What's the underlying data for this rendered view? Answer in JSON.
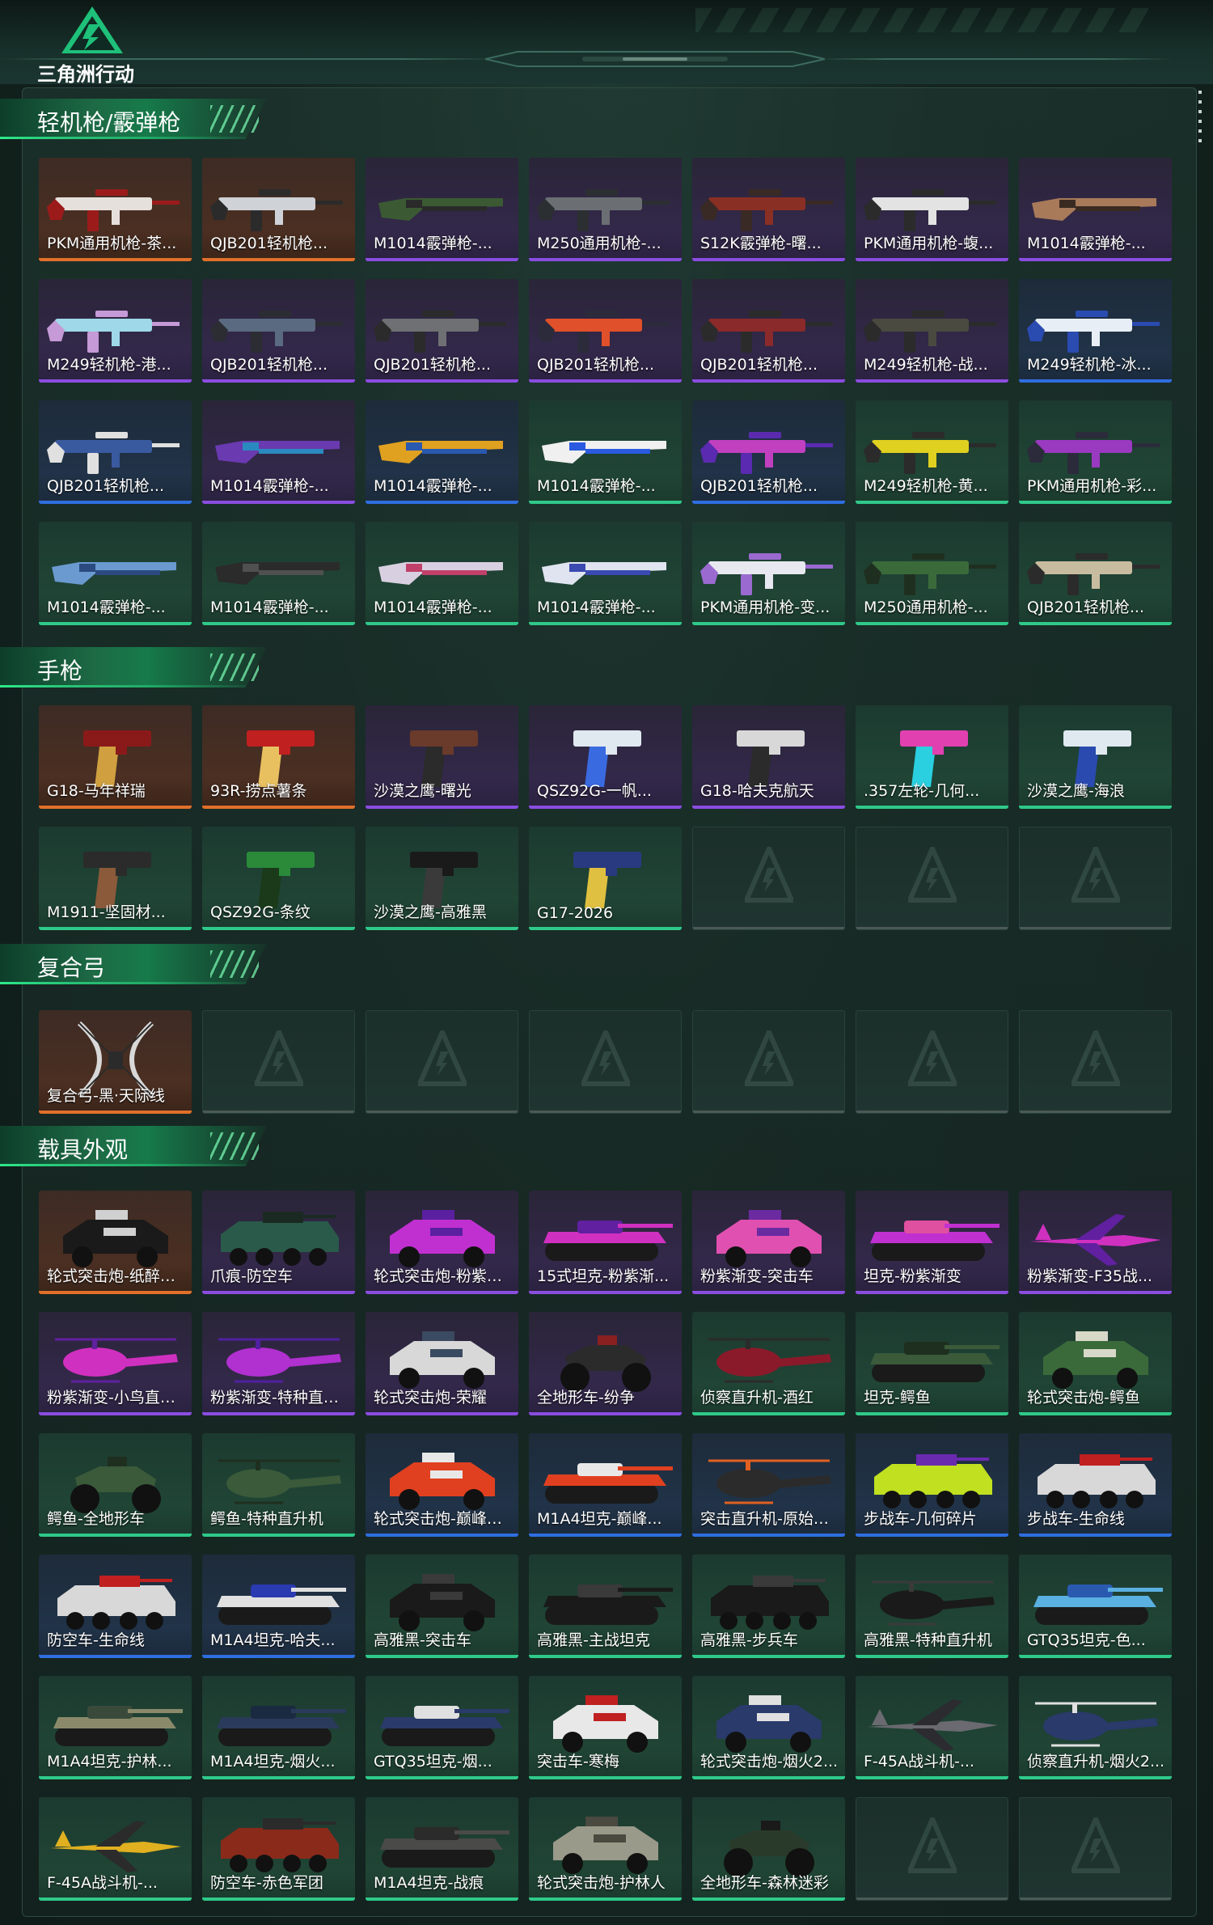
{
  "app": {
    "logo_text": "三角洲行动"
  },
  "sections": [
    {
      "title": "轻机枪/霰弹枪",
      "items": [
        {
          "label": "PKM通用机枪-茶...",
          "rarity": "orange",
          "kind": "rifle",
          "c1": "#e6e0dc",
          "c2": "#9b1b1b"
        },
        {
          "label": "QJB201轻机枪...",
          "rarity": "orange",
          "kind": "rifle",
          "c1": "#cfd2d6",
          "c2": "#2b2b2b"
        },
        {
          "label": "M1014霰弹枪-...",
          "rarity": "purple",
          "kind": "shotgun",
          "c1": "#3b5a33",
          "c2": "#2a2a2a"
        },
        {
          "label": "M250通用机枪-...",
          "rarity": "purple",
          "kind": "rifle",
          "c1": "#6b6f73",
          "c2": "#2c2f31"
        },
        {
          "label": "S12K霰弹枪-曙...",
          "rarity": "purple",
          "kind": "rifle",
          "c1": "#8a2f24",
          "c2": "#3a2a25"
        },
        {
          "label": "PKM通用机枪-蝮...",
          "rarity": "purple",
          "kind": "rifle",
          "c1": "#e3e3e3",
          "c2": "#2b2b2b"
        },
        {
          "label": "M1014霰弹枪-...",
          "rarity": "purple",
          "kind": "shotgun",
          "c1": "#a87a5a",
          "c2": "#3a2b22"
        },
        {
          "label": "M249轻机枪-港...",
          "rarity": "purple",
          "kind": "rifle",
          "c1": "#9fd8e8",
          "c2": "#c59ad6"
        },
        {
          "label": "QJB201轻机枪...",
          "rarity": "purple",
          "kind": "rifle",
          "c1": "#5a6a80",
          "c2": "#2b2d33"
        },
        {
          "label": "QJB201轻机枪...",
          "rarity": "purple",
          "kind": "rifle",
          "c1": "#6e7073",
          "c2": "#2b2b2b"
        },
        {
          "label": "QJB201轻机枪...",
          "rarity": "purple",
          "kind": "rifle",
          "c1": "#e0502a",
          "c2": "#2b2b3b"
        },
        {
          "label": "QJB201轻机枪...",
          "rarity": "purple",
          "kind": "rifle",
          "c1": "#8a2a2a",
          "c2": "#2b2b2b"
        },
        {
          "label": "M249轻机枪-战...",
          "rarity": "purple",
          "kind": "rifle",
          "c1": "#4a4a40",
          "c2": "#2b2b2b"
        },
        {
          "label": "M249轻机枪-冰...",
          "rarity": "blue",
          "kind": "rifle",
          "c1": "#e8eef5",
          "c2": "#2a4bb0"
        },
        {
          "label": "QJB201轻机枪...",
          "rarity": "blue",
          "kind": "rifle",
          "c1": "#3a5aa0",
          "c2": "#e0e0e0"
        },
        {
          "label": "M1014霰弹枪-...",
          "rarity": "purple",
          "kind": "shotgun",
          "c1": "#6a3ab0",
          "c2": "#2a8ac0"
        },
        {
          "label": "M1014霰弹枪-...",
          "rarity": "blue",
          "kind": "shotgun",
          "c1": "#e0a020",
          "c2": "#2a5ab0"
        },
        {
          "label": "M1014霰弹枪-...",
          "rarity": "green",
          "kind": "shotgun",
          "c1": "#f0f0f0",
          "c2": "#2a5ae0"
        },
        {
          "label": "QJB201轻机枪...",
          "rarity": "blue",
          "kind": "rifle",
          "c1": "#c040c0",
          "c2": "#5a2ab0"
        },
        {
          "label": "M249轻机枪-黄...",
          "rarity": "green",
          "kind": "rifle",
          "c1": "#e0d020",
          "c2": "#2b2b2b"
        },
        {
          "label": "PKM通用机枪-彩...",
          "rarity": "green",
          "kind": "rifle",
          "c1": "#9a3ac0",
          "c2": "#2b2b3b"
        },
        {
          "label": "M1014霰弹枪-...",
          "rarity": "green",
          "kind": "shotgun",
          "c1": "#6a9ad0",
          "c2": "#2a4a80"
        },
        {
          "label": "M1014霰弹枪-...",
          "rarity": "green",
          "kind": "shotgun",
          "c1": "#2b2b2b",
          "c2": "#505050"
        },
        {
          "label": "M1014霰弹枪-...",
          "rarity": "green",
          "kind": "shotgun",
          "c1": "#d8d0e0",
          "c2": "#c0406a"
        },
        {
          "label": "M1014霰弹枪-...",
          "rarity": "green",
          "kind": "shotgun",
          "c1": "#e0e4f0",
          "c2": "#3a4ab0"
        },
        {
          "label": "PKM通用机枪-变...",
          "rarity": "green",
          "kind": "rifle",
          "c1": "#e8e8f0",
          "c2": "#9a6ad0"
        },
        {
          "label": "M250通用机枪-...",
          "rarity": "green",
          "kind": "rifle",
          "c1": "#3a6a3a",
          "c2": "#1f2f1f"
        },
        {
          "label": "QJB201轻机枪...",
          "rarity": "green",
          "kind": "rifle",
          "c1": "#c8bca0",
          "c2": "#2b2b2b"
        }
      ]
    },
    {
      "title": "手枪",
      "items": [
        {
          "label": "G18-马年祥瑞",
          "rarity": "orange",
          "kind": "pistol",
          "c1": "#8a1a1a",
          "c2": "#d0a040"
        },
        {
          "label": "93R-捞点薯条",
          "rarity": "orange",
          "kind": "pistol",
          "c1": "#c02020",
          "c2": "#e8c060"
        },
        {
          "label": "沙漠之鹰-曙光",
          "rarity": "purple",
          "kind": "pistol",
          "c1": "#6a3a2a",
          "c2": "#2b2b2b"
        },
        {
          "label": "QSZ92G-一帆...",
          "rarity": "purple",
          "kind": "pistol",
          "c1": "#e0e8f0",
          "c2": "#3a6ae0"
        },
        {
          "label": "G18-哈夫克航天",
          "rarity": "purple",
          "kind": "pistol",
          "c1": "#d8d8d8",
          "c2": "#2b2b2b"
        },
        {
          "label": ".357左轮-几何...",
          "rarity": "green",
          "kind": "pistol",
          "c1": "#e040b0",
          "c2": "#2ad0e0"
        },
        {
          "label": "沙漠之鹰-海浪",
          "rarity": "green",
          "kind": "pistol",
          "c1": "#e0e8f0",
          "c2": "#2a4ab0"
        },
        {
          "label": "M1911-坚固材...",
          "rarity": "green",
          "kind": "pistol",
          "c1": "#2b2b2b",
          "c2": "#8a5a3a"
        },
        {
          "label": "QSZ92G-条纹",
          "rarity": "green",
          "kind": "pistol",
          "c1": "#2a8a3a",
          "c2": "#1a3a1a"
        },
        {
          "label": "沙漠之鹰-高雅黑",
          "rarity": "green",
          "kind": "pistol",
          "c1": "#1a1a1a",
          "c2": "#3a3a3a"
        },
        {
          "label": "G17-2026",
          "rarity": "green",
          "kind": "pistol",
          "c1": "#2a3a80",
          "c2": "#e0c040"
        },
        {
          "label": "",
          "rarity": "empty"
        },
        {
          "label": "",
          "rarity": "empty"
        },
        {
          "label": "",
          "rarity": "empty"
        }
      ]
    },
    {
      "title": "复合弓",
      "items": [
        {
          "label": "复合弓-黑·天际线",
          "rarity": "orange",
          "kind": "bow",
          "c1": "#d8d8d8",
          "c2": "#2b2b2b"
        },
        {
          "label": "",
          "rarity": "empty"
        },
        {
          "label": "",
          "rarity": "empty"
        },
        {
          "label": "",
          "rarity": "empty"
        },
        {
          "label": "",
          "rarity": "empty"
        },
        {
          "label": "",
          "rarity": "empty"
        },
        {
          "label": "",
          "rarity": "empty"
        }
      ]
    },
    {
      "title": "载具外观",
      "items": [
        {
          "label": "轮式突击炮-纸醉金...",
          "rarity": "orange",
          "kind": "car",
          "c1": "#1a1a1a",
          "c2": "#d0d0d0"
        },
        {
          "label": "爪痕-防空车",
          "rarity": "purple",
          "kind": "apc",
          "c1": "#2a5a4a",
          "c2": "#1a2a22"
        },
        {
          "label": "轮式突击炮-粉紫渐...",
          "rarity": "purple",
          "kind": "car",
          "c1": "#c030d0",
          "c2": "#5a20a0"
        },
        {
          "label": "15式坦克-粉紫渐...",
          "rarity": "purple",
          "kind": "tank",
          "c1": "#d030c0",
          "c2": "#6020a0"
        },
        {
          "label": "粉紫渐变-突击车",
          "rarity": "purple",
          "kind": "car",
          "c1": "#e050b0",
          "c2": "#6a2aa0"
        },
        {
          "label": "坦克-粉紫渐变",
          "rarity": "purple",
          "kind": "tank",
          "c1": "#c030d0",
          "c2": "#e050a0"
        },
        {
          "label": "粉紫渐变-F35战...",
          "rarity": "purple",
          "kind": "jet",
          "c1": "#d030c0",
          "c2": "#6020a0"
        },
        {
          "label": "粉紫渐变-小鸟直升...",
          "rarity": "purple",
          "kind": "heli",
          "c1": "#d030c0",
          "c2": "#6020a0"
        },
        {
          "label": "粉紫渐变-特种直升...",
          "rarity": "purple",
          "kind": "heli",
          "c1": "#b030d0",
          "c2": "#5020a0"
        },
        {
          "label": "轮式突击炮-荣耀",
          "rarity": "purple",
          "kind": "car",
          "c1": "#d8d8d8",
          "c2": "#3a4a60"
        },
        {
          "label": "全地形车-纷争",
          "rarity": "purple",
          "kind": "atv",
          "c1": "#2b2b2b",
          "c2": "#8a2020"
        },
        {
          "label": "侦察直升机-酒红",
          "rarity": "green",
          "kind": "heli",
          "c1": "#8a1a2a",
          "c2": "#2b2b2b"
        },
        {
          "label": "坦克-鳄鱼",
          "rarity": "green",
          "kind": "tank",
          "c1": "#3a5a3a",
          "c2": "#1f2f1f"
        },
        {
          "label": "轮式突击炮-鳄鱼",
          "rarity": "green",
          "kind": "car",
          "c1": "#3a6a3a",
          "c2": "#d8d8c8"
        },
        {
          "label": "鳄鱼-全地形车",
          "rarity": "green",
          "kind": "atv",
          "c1": "#3a5a3a",
          "c2": "#1f2f1f"
        },
        {
          "label": "鳄鱼-特种直升机",
          "rarity": "green",
          "kind": "heli",
          "c1": "#3a5a3a",
          "c2": "#1f2f1f"
        },
        {
          "label": "轮式突击炮-巅峰竞...",
          "rarity": "blue",
          "kind": "car",
          "c1": "#e04020",
          "c2": "#e8e8e8"
        },
        {
          "label": "M1A4坦克-巅峰...",
          "rarity": "blue",
          "kind": "tank",
          "c1": "#e04020",
          "c2": "#e8e8e8"
        },
        {
          "label": "突击直升机-原始伪...",
          "rarity": "blue",
          "kind": "heli",
          "c1": "#2b2b2b",
          "c2": "#e06020"
        },
        {
          "label": "步战车-几何碎片",
          "rarity": "blue",
          "kind": "apc",
          "c1": "#c0e020",
          "c2": "#6a2ab0"
        },
        {
          "label": "步战车-生命线",
          "rarity": "blue",
          "kind": "apc",
          "c1": "#d8d8d8",
          "c2": "#c02020"
        },
        {
          "label": "防空车-生命线",
          "rarity": "blue",
          "kind": "apc",
          "c1": "#d8d8d8",
          "c2": "#c02020"
        },
        {
          "label": "M1A4坦克-哈夫...",
          "rarity": "blue",
          "kind": "tank",
          "c1": "#e0e0e0",
          "c2": "#2a3ab0"
        },
        {
          "label": "高雅黑-突击车",
          "rarity": "green",
          "kind": "car",
          "c1": "#1a1a1a",
          "c2": "#3a3a3a"
        },
        {
          "label": "高雅黑-主战坦克",
          "rarity": "green",
          "kind": "tank",
          "c1": "#1a1a1a",
          "c2": "#3a3a3a"
        },
        {
          "label": "高雅黑-步兵车",
          "rarity": "green",
          "kind": "apc",
          "c1": "#1a1a1a",
          "c2": "#3a3a3a"
        },
        {
          "label": "高雅黑-特种直升机",
          "rarity": "green",
          "kind": "heli",
          "c1": "#1a1a1a",
          "c2": "#3a3a3a"
        },
        {
          "label": "GTQ35坦克-色...",
          "rarity": "green",
          "kind": "tank",
          "c1": "#5ab0e0",
          "c2": "#2a5ab0"
        },
        {
          "label": "M1A4坦克-护林...",
          "rarity": "green",
          "kind": "tank",
          "c1": "#8a8a6a",
          "c2": "#3a4a3a"
        },
        {
          "label": "M1A4坦克-烟火...",
          "rarity": "green",
          "kind": "tank",
          "c1": "#2a3a5a",
          "c2": "#1a2a40"
        },
        {
          "label": "GTQ35坦克-烟...",
          "rarity": "green",
          "kind": "tank",
          "c1": "#2a3a6a",
          "c2": "#e0e0e0"
        },
        {
          "label": "突击车-寒梅",
          "rarity": "green",
          "kind": "car",
          "c1": "#e8e8e8",
          "c2": "#c02020"
        },
        {
          "label": "轮式突击炮-烟火2...",
          "rarity": "green",
          "kind": "car",
          "c1": "#2a3a6a",
          "c2": "#e0e0e0"
        },
        {
          "label": "F-45A战斗机-...",
          "rarity": "green",
          "kind": "jet",
          "c1": "#6a6a70",
          "c2": "#2b2b30"
        },
        {
          "label": "侦察直升机-烟火2...",
          "rarity": "green",
          "kind": "heli",
          "c1": "#2a3a6a",
          "c2": "#e0e0e0"
        },
        {
          "label": "F-45A战斗机-...",
          "rarity": "green",
          "kind": "jet",
          "c1": "#e0b020",
          "c2": "#2b2b2b"
        },
        {
          "label": "防空车-赤色军团",
          "rarity": "green",
          "kind": "apc",
          "c1": "#8a2a1a",
          "c2": "#2b2b2b"
        },
        {
          "label": "M1A4坦克-战痕",
          "rarity": "green",
          "kind": "tank",
          "c1": "#4a4a48",
          "c2": "#2b2b2b"
        },
        {
          "label": "轮式突击炮-护林人",
          "rarity": "green",
          "kind": "car",
          "c1": "#9a9a8a",
          "c2": "#4a4a40"
        },
        {
          "label": "全地形车-森林迷彩",
          "rarity": "green",
          "kind": "atv",
          "c1": "#2a3a2a",
          "c2": "#1a1a1a"
        },
        {
          "label": "",
          "rarity": "empty"
        },
        {
          "label": "",
          "rarity": "empty"
        }
      ]
    }
  ]
}
